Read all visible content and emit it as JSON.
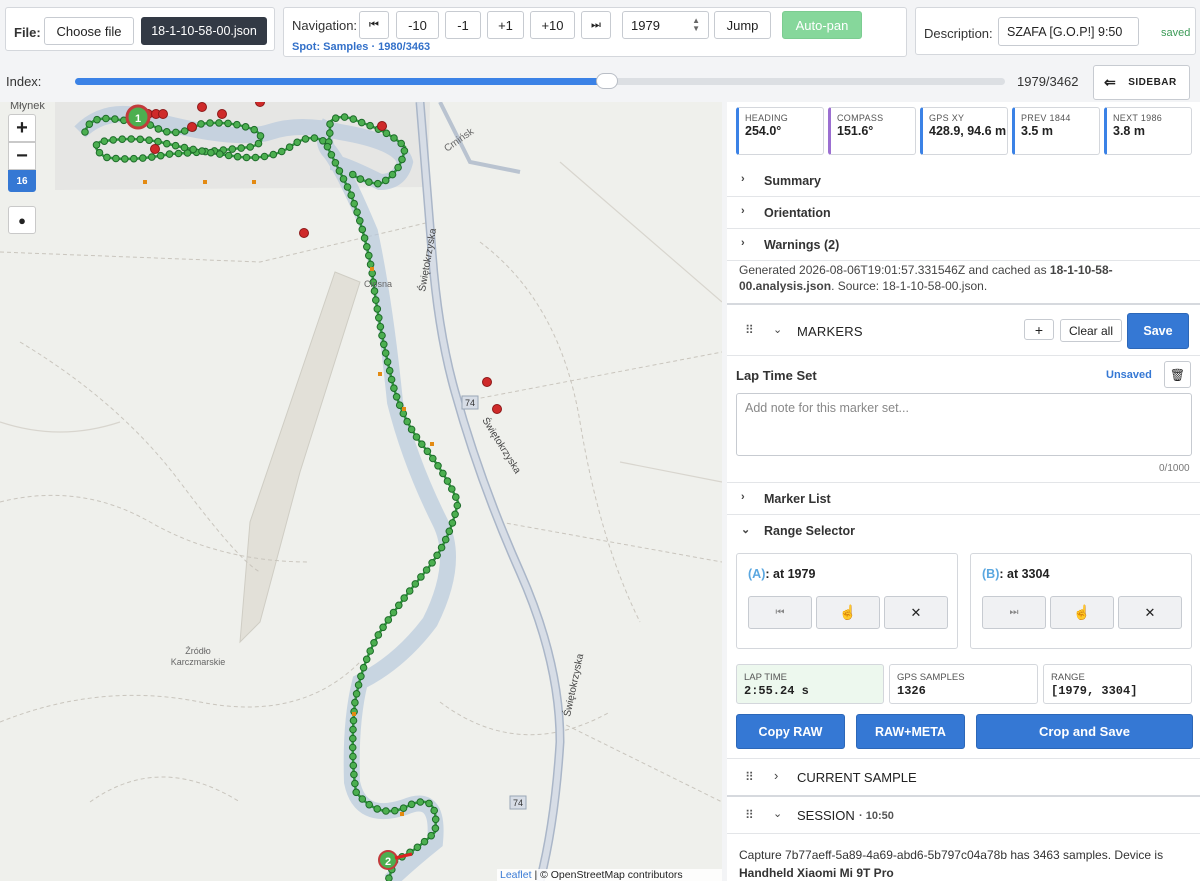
{
  "file": {
    "label": "File:",
    "choose": "Choose file",
    "name": "18-1-10-58-00.json"
  },
  "nav": {
    "label": "Navigation:",
    "first": "⏮",
    "m10": "-10",
    "m1": "-1",
    "p1": "+1",
    "p10": "+10",
    "last": "⏭",
    "index_value": "1979",
    "jump": "Jump",
    "autopan": "Auto-pan",
    "spot": "Spot: Samples · 1980/3463"
  },
  "desc": {
    "label": "Description:",
    "value": "SZAFA [G.O.P!] 9:50",
    "status": "saved"
  },
  "index": {
    "label": "Index:",
    "value": "1979/3462",
    "progress": 0.5716,
    "sidebar": "SIDEBAR"
  },
  "map": {
    "zoom": "16",
    "labels": {
      "mlynek": "Młynek",
      "cminsk": "Cmińsk",
      "road": "Świętokrzyska",
      "road2": "Świętokrzyska",
      "road3": "Świętokrzyska",
      "n74a": "74",
      "n74b": "74",
      "zrodlo1": "Źródło",
      "zrodlo2": "Karczmarskie",
      "ciosna": "Ciosna"
    },
    "marker_start": "1",
    "marker_end": "2",
    "attribution_leaflet": "Leaflet",
    "attribution_osm": "| © OpenStreetMap contributors"
  },
  "stats": [
    {
      "key": "HEADING",
      "value": "254.0°",
      "color": "#3b82e6"
    },
    {
      "key": "COMPASS",
      "value": "151.6°",
      "color": "#9b6fd1"
    },
    {
      "key": "GPS XY",
      "value": "428.9, 94.6 m",
      "color": "#3b82e6"
    },
    {
      "key": "PREV 1844",
      "value": "3.5 m",
      "color": "#3b82e6"
    },
    {
      "key": "NEXT 1986",
      "value": "3.8 m",
      "color": "#3b82e6"
    }
  ],
  "sections": {
    "summary": "Summary",
    "orientation": "Orientation",
    "warnings": "Warnings (2)"
  },
  "generated": {
    "prefix": "Generated 2026-08-06T19:01:57.331546Z and cached as ",
    "cache": "18-1-10-58-00.analysis.json",
    "suffix": ". Source: 18-1-10-58-00.json."
  },
  "markers": {
    "title": "MARKERS",
    "add": "+",
    "clear": "Clear all",
    "save": "Save",
    "set_name": "Lap Time Set",
    "status": "Unsaved",
    "note_placeholder": "Add note for this marker set...",
    "count": "0/1000",
    "list": "Marker List",
    "range": "Range Selector"
  },
  "range": {
    "a_label": "(A)",
    "a_text": ": at 1979",
    "b_label": "(B)",
    "b_text": ": at 3304",
    "lap_key": "LAP TIME",
    "lap_value": "2:55.24 s",
    "gps_key": "GPS SAMPLES",
    "gps_value": "1326",
    "range_key": "RANGE",
    "range_value": "[1979, 3304]",
    "copy_raw": "Copy RAW",
    "raw_meta": "RAW+META",
    "crop": "Crop and Save"
  },
  "current_sample": "CURRENT SAMPLE",
  "session": {
    "title": "SESSION",
    "time": "· 10:50",
    "text1": "Capture 7b77aeff-5a89-4a69-abd6-5b797c04a78b has 3463 samples. Device is",
    "text2": "Handheld Xiaomi Mi 9T Pro"
  }
}
